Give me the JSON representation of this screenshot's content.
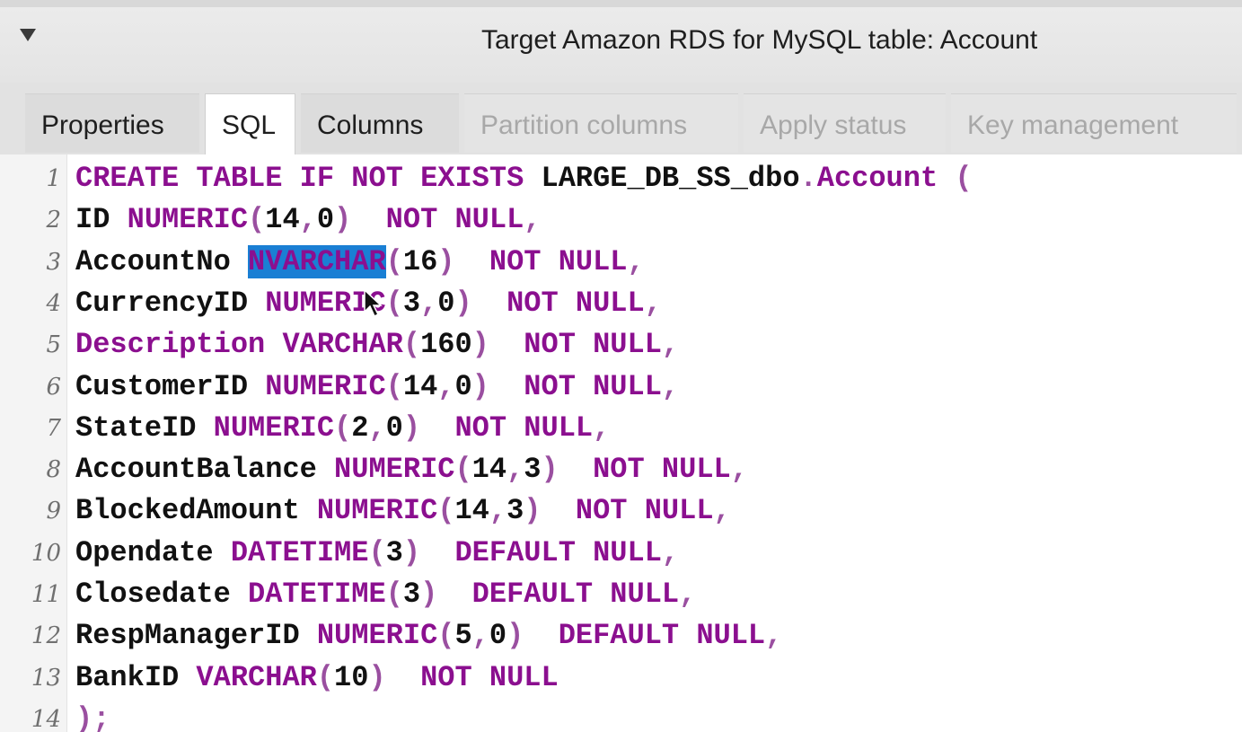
{
  "header": {
    "title": "Target Amazon RDS for MySQL table: Account",
    "toggle_icon": "triangle-down-icon"
  },
  "tabs": [
    {
      "label": "Properties",
      "state": "normal"
    },
    {
      "label": "SQL",
      "state": "active"
    },
    {
      "label": "Columns",
      "state": "normal"
    },
    {
      "label": "Partition columns",
      "state": "disabled"
    },
    {
      "label": "Apply status",
      "state": "disabled"
    },
    {
      "label": "Key management",
      "state": "disabled"
    }
  ],
  "editor": {
    "line_numbers": [
      "1",
      "2",
      "3",
      "4",
      "5",
      "6",
      "7",
      "8",
      "9",
      "10",
      "11",
      "12",
      "13",
      "14"
    ],
    "selected_text": "NVARCHAR",
    "lines": [
      [
        {
          "t": "CREATE TABLE IF NOT EXISTS ",
          "c": "kw"
        },
        {
          "t": "LARGE_DB_SS_dbo",
          "c": "id"
        },
        {
          "t": ".",
          "c": "punc"
        },
        {
          "t": "Account",
          "c": "kw"
        },
        {
          "t": " (",
          "c": "punc"
        }
      ],
      [
        {
          "t": "ID ",
          "c": "id"
        },
        {
          "t": "NUMERIC",
          "c": "kw"
        },
        {
          "t": "(",
          "c": "punc"
        },
        {
          "t": "14",
          "c": "num"
        },
        {
          "t": ",",
          "c": "punc"
        },
        {
          "t": "0",
          "c": "num"
        },
        {
          "t": ")  ",
          "c": "punc"
        },
        {
          "t": "NOT NULL",
          "c": "kw"
        },
        {
          "t": ",",
          "c": "punc"
        }
      ],
      [
        {
          "t": "AccountNo ",
          "c": "id"
        },
        {
          "t": "NVARCHAR",
          "c": "sel"
        },
        {
          "t": "(",
          "c": "punc"
        },
        {
          "t": "16",
          "c": "num"
        },
        {
          "t": ")  ",
          "c": "punc"
        },
        {
          "t": "NOT NULL",
          "c": "kw"
        },
        {
          "t": ",",
          "c": "punc"
        }
      ],
      [
        {
          "t": "CurrencyID ",
          "c": "id"
        },
        {
          "t": "NUMERIC",
          "c": "kw"
        },
        {
          "t": "(",
          "c": "punc"
        },
        {
          "t": "3",
          "c": "num"
        },
        {
          "t": ",",
          "c": "punc"
        },
        {
          "t": "0",
          "c": "num"
        },
        {
          "t": ")  ",
          "c": "punc"
        },
        {
          "t": "NOT NULL",
          "c": "kw"
        },
        {
          "t": ",",
          "c": "punc"
        }
      ],
      [
        {
          "t": "Description VARCHAR",
          "c": "kw"
        },
        {
          "t": "(",
          "c": "punc"
        },
        {
          "t": "160",
          "c": "num"
        },
        {
          "t": ")  ",
          "c": "punc"
        },
        {
          "t": "NOT NULL",
          "c": "kw"
        },
        {
          "t": ",",
          "c": "punc"
        }
      ],
      [
        {
          "t": "CustomerID ",
          "c": "id"
        },
        {
          "t": "NUMERIC",
          "c": "kw"
        },
        {
          "t": "(",
          "c": "punc"
        },
        {
          "t": "14",
          "c": "num"
        },
        {
          "t": ",",
          "c": "punc"
        },
        {
          "t": "0",
          "c": "num"
        },
        {
          "t": ")  ",
          "c": "punc"
        },
        {
          "t": "NOT NULL",
          "c": "kw"
        },
        {
          "t": ",",
          "c": "punc"
        }
      ],
      [
        {
          "t": "StateID ",
          "c": "id"
        },
        {
          "t": "NUMERIC",
          "c": "kw"
        },
        {
          "t": "(",
          "c": "punc"
        },
        {
          "t": "2",
          "c": "num"
        },
        {
          "t": ",",
          "c": "punc"
        },
        {
          "t": "0",
          "c": "num"
        },
        {
          "t": ")  ",
          "c": "punc"
        },
        {
          "t": "NOT NULL",
          "c": "kw"
        },
        {
          "t": ",",
          "c": "punc"
        }
      ],
      [
        {
          "t": "AccountBalance ",
          "c": "id"
        },
        {
          "t": "NUMERIC",
          "c": "kw"
        },
        {
          "t": "(",
          "c": "punc"
        },
        {
          "t": "14",
          "c": "num"
        },
        {
          "t": ",",
          "c": "punc"
        },
        {
          "t": "3",
          "c": "num"
        },
        {
          "t": ")  ",
          "c": "punc"
        },
        {
          "t": "NOT NULL",
          "c": "kw"
        },
        {
          "t": ",",
          "c": "punc"
        }
      ],
      [
        {
          "t": "BlockedAmount ",
          "c": "id"
        },
        {
          "t": "NUMERIC",
          "c": "kw"
        },
        {
          "t": "(",
          "c": "punc"
        },
        {
          "t": "14",
          "c": "num"
        },
        {
          "t": ",",
          "c": "punc"
        },
        {
          "t": "3",
          "c": "num"
        },
        {
          "t": ")  ",
          "c": "punc"
        },
        {
          "t": "NOT NULL",
          "c": "kw"
        },
        {
          "t": ",",
          "c": "punc"
        }
      ],
      [
        {
          "t": "Opendate ",
          "c": "id"
        },
        {
          "t": "DATETIME",
          "c": "kw"
        },
        {
          "t": "(",
          "c": "punc"
        },
        {
          "t": "3",
          "c": "num"
        },
        {
          "t": ")  ",
          "c": "punc"
        },
        {
          "t": "DEFAULT NULL",
          "c": "kw"
        },
        {
          "t": ",",
          "c": "punc"
        }
      ],
      [
        {
          "t": "Closedate ",
          "c": "id"
        },
        {
          "t": "DATETIME",
          "c": "kw"
        },
        {
          "t": "(",
          "c": "punc"
        },
        {
          "t": "3",
          "c": "num"
        },
        {
          "t": ")  ",
          "c": "punc"
        },
        {
          "t": "DEFAULT NULL",
          "c": "kw"
        },
        {
          "t": ",",
          "c": "punc"
        }
      ],
      [
        {
          "t": "RespManagerID ",
          "c": "id"
        },
        {
          "t": "NUMERIC",
          "c": "kw"
        },
        {
          "t": "(",
          "c": "punc"
        },
        {
          "t": "5",
          "c": "num"
        },
        {
          "t": ",",
          "c": "punc"
        },
        {
          "t": "0",
          "c": "num"
        },
        {
          "t": ")  ",
          "c": "punc"
        },
        {
          "t": "DEFAULT NULL",
          "c": "kw"
        },
        {
          "t": ",",
          "c": "punc"
        }
      ],
      [
        {
          "t": "BankID ",
          "c": "id"
        },
        {
          "t": "VARCHAR",
          "c": "kw"
        },
        {
          "t": "(",
          "c": "punc"
        },
        {
          "t": "10",
          "c": "num"
        },
        {
          "t": ")  ",
          "c": "punc"
        },
        {
          "t": "NOT NULL",
          "c": "kw"
        }
      ],
      [
        {
          "t": ");",
          "c": "punc"
        }
      ]
    ]
  },
  "colors": {
    "keyword": "#8b0f8f",
    "identifier": "#111111",
    "punctuation": "#9a4fa0",
    "selection": "#1a7fd4"
  },
  "mouse_cursor_icon": "arrow-pointer-icon"
}
